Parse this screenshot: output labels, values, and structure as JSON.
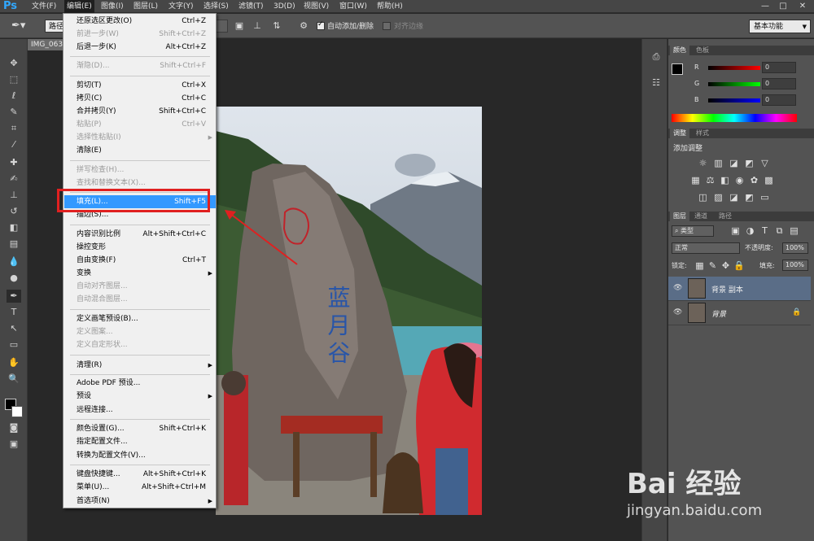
{
  "app": {
    "logo": "Ps"
  },
  "menubar": {
    "items": [
      "文件(F)",
      "编辑(E)",
      "图像(I)",
      "图层(L)",
      "文字(Y)",
      "选择(S)",
      "滤镜(T)",
      "3D(D)",
      "视图(V)",
      "窗口(W)",
      "帮助(H)"
    ],
    "active_index": 1
  },
  "window_controls": {
    "minimize": "—",
    "maximize": "□",
    "close": "✕"
  },
  "options_bar": {
    "path_mode": "路径",
    "auto_add_delete": "自动添加/删除",
    "align_edges": "对齐边缘",
    "auto_add_checked": true,
    "workspace": "基本功能"
  },
  "document": {
    "tab_title": "IMG_063"
  },
  "edit_menu": {
    "items": [
      {
        "label": "还原选区更改(O)",
        "shortcut": "Ctrl+Z",
        "enabled": true
      },
      {
        "label": "前进一步(W)",
        "shortcut": "Shift+Ctrl+Z",
        "enabled": false
      },
      {
        "label": "后退一步(K)",
        "shortcut": "Alt+Ctrl+Z",
        "enabled": true
      },
      {
        "label": "渐隐(D)...",
        "shortcut": "Shift+Ctrl+F",
        "enabled": false
      },
      {
        "label": "剪切(T)",
        "shortcut": "Ctrl+X",
        "enabled": true
      },
      {
        "label": "拷贝(C)",
        "shortcut": "Ctrl+C",
        "enabled": true
      },
      {
        "label": "合并拷贝(Y)",
        "shortcut": "Shift+Ctrl+C",
        "enabled": true
      },
      {
        "label": "粘贴(P)",
        "shortcut": "Ctrl+V",
        "enabled": false
      },
      {
        "label": "选择性粘贴(I)",
        "shortcut": "",
        "enabled": false,
        "submenu": true
      },
      {
        "label": "清除(E)",
        "shortcut": "",
        "enabled": true
      },
      {
        "label": "拼写检查(H)...",
        "shortcut": "",
        "enabled": false
      },
      {
        "label": "查找和替换文本(X)...",
        "shortcut": "",
        "enabled": false
      },
      {
        "label": "填充(L)...",
        "shortcut": "Shift+F5",
        "enabled": true,
        "selected": true
      },
      {
        "label": "描边(S)...",
        "shortcut": "",
        "enabled": true
      },
      {
        "label": "内容识别比例",
        "shortcut": "Alt+Shift+Ctrl+C",
        "enabled": true
      },
      {
        "label": "操控变形",
        "shortcut": "",
        "enabled": true
      },
      {
        "label": "自由变换(F)",
        "shortcut": "Ctrl+T",
        "enabled": true
      },
      {
        "label": "变换",
        "shortcut": "",
        "enabled": true,
        "submenu": true
      },
      {
        "label": "自动对齐图层...",
        "shortcut": "",
        "enabled": false
      },
      {
        "label": "自动混合图层...",
        "shortcut": "",
        "enabled": false
      },
      {
        "label": "定义画笔预设(B)...",
        "shortcut": "",
        "enabled": true
      },
      {
        "label": "定义图案...",
        "shortcut": "",
        "enabled": false
      },
      {
        "label": "定义自定形状...",
        "shortcut": "",
        "enabled": false
      },
      {
        "label": "清理(R)",
        "shortcut": "",
        "enabled": true,
        "submenu": true
      },
      {
        "label": "Adobe PDF 预设...",
        "shortcut": "",
        "enabled": true
      },
      {
        "label": "预设",
        "shortcut": "",
        "enabled": true,
        "submenu": true
      },
      {
        "label": "远程连接...",
        "shortcut": "",
        "enabled": true
      },
      {
        "label": "颜色设置(G)...",
        "shortcut": "Shift+Ctrl+K",
        "enabled": true
      },
      {
        "label": "指定配置文件...",
        "shortcut": "",
        "enabled": true
      },
      {
        "label": "转换为配置文件(V)...",
        "shortcut": "",
        "enabled": true
      },
      {
        "label": "键盘快捷键...",
        "shortcut": "Alt+Shift+Ctrl+K",
        "enabled": true
      },
      {
        "label": "菜单(U)...",
        "shortcut": "Alt+Shift+Ctrl+M",
        "enabled": true
      },
      {
        "label": "首选项(N)",
        "shortcut": "",
        "enabled": true,
        "submenu": true
      }
    ]
  },
  "color_panel": {
    "tabs": [
      "颜色",
      "色板"
    ],
    "channels": [
      {
        "name": "R",
        "value": "0"
      },
      {
        "name": "G",
        "value": "0"
      },
      {
        "name": "B",
        "value": "0"
      }
    ]
  },
  "adjust_panel": {
    "tabs": [
      "调整",
      "样式"
    ],
    "title": "添加调整"
  },
  "layers_panel": {
    "tabs": [
      "图层",
      "通道",
      "路径"
    ],
    "filter": "类型",
    "blend_mode": "正常",
    "opacity_label": "不透明度:",
    "opacity": "100%",
    "lock_label": "锁定:",
    "fill_label": "填充:",
    "fill": "100%",
    "layers": [
      {
        "name": "背景 副本",
        "selected": true
      },
      {
        "name": "背景",
        "selected": false,
        "locked": true
      }
    ]
  },
  "photo_text": {
    "inscription": "蓝月谷"
  },
  "watermark": {
    "brand": "Bai 经验",
    "url": "jingyan.baidu.com"
  },
  "colors": {
    "accent": "#3399ff",
    "highlight": "#e02020",
    "brand_blue": "#31a8ff"
  }
}
